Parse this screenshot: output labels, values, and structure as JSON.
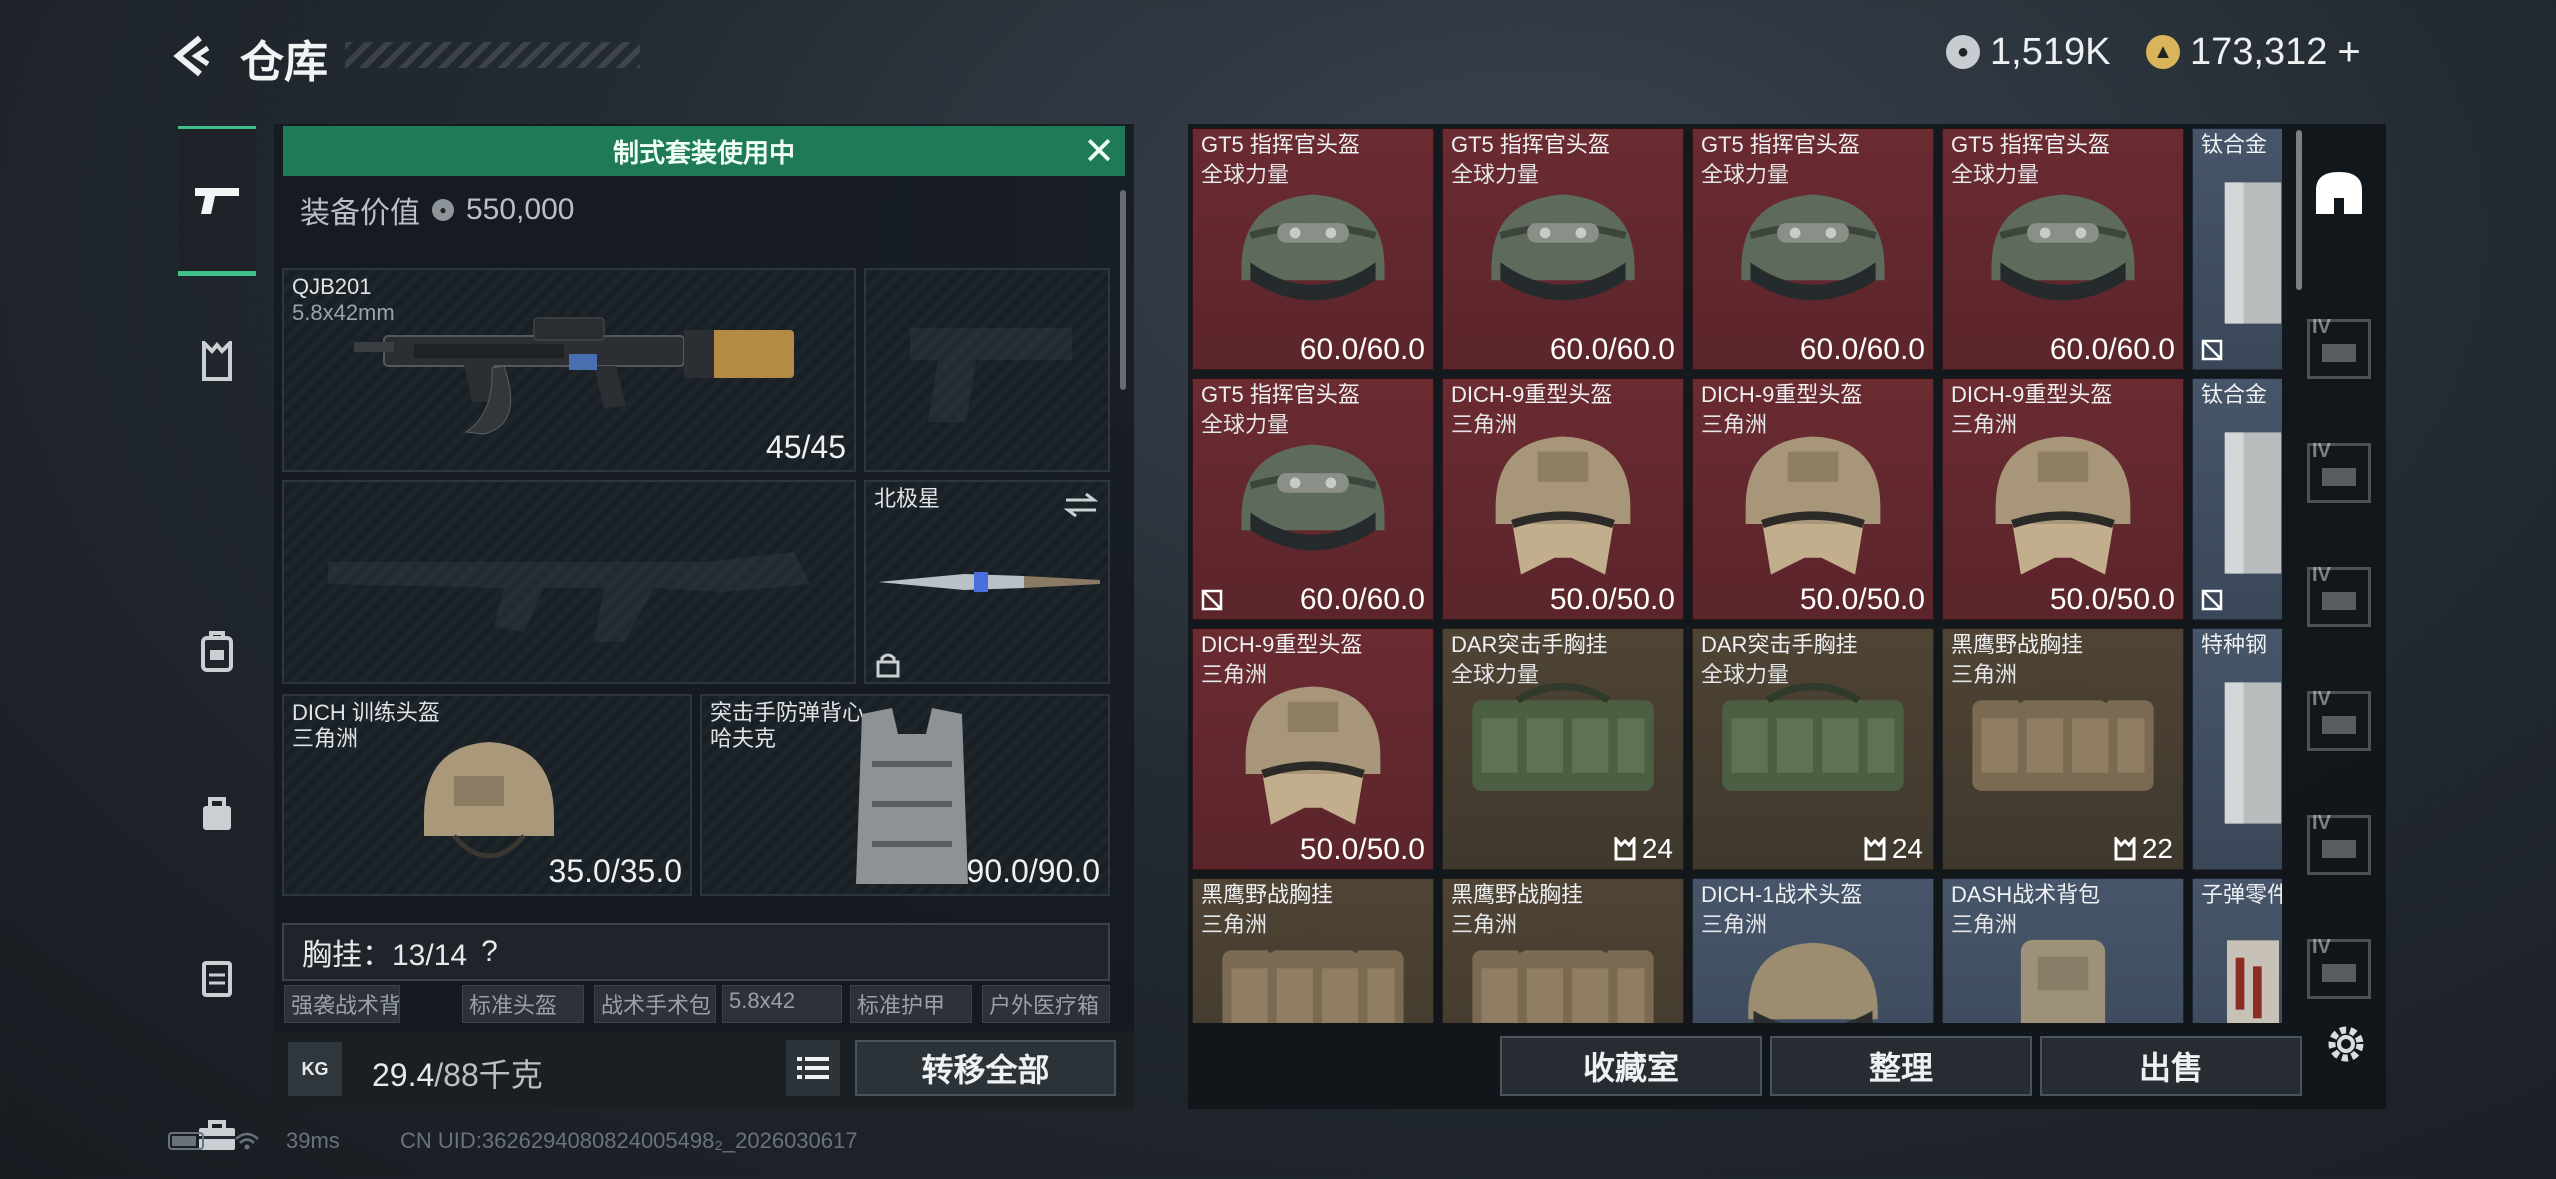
{
  "header": {
    "title": "仓库",
    "currency_primary": "1,519K",
    "currency_secondary": "173,312",
    "currency_add": "+"
  },
  "loadout": {
    "banner": "制式套装使用中",
    "equip_value_label": "装备价值",
    "equip_value": "550,000",
    "primary_weapon": {
      "name": "QJB201",
      "caliber": "5.8x42mm",
      "ammo": "45/45"
    },
    "melee": {
      "name": "北极星"
    },
    "helmet": {
      "name": "DICH 训练头盔",
      "map": "三角洲",
      "durability": "35.0/35.0"
    },
    "armor": {
      "name": "突击手防弹背心",
      "map": "哈夫克",
      "durability": "90.0/90.0"
    },
    "chest_label": "胸挂：13/14",
    "chest_help": "?",
    "chips": [
      "强袭战术背心",
      "标准头盔",
      "战术手术包",
      "5.8x42",
      "标准护甲",
      "户外医疗箱"
    ],
    "weight": "29.4",
    "weight_max": "/88千克",
    "kg_label": "KG",
    "transfer_all": "转移全部"
  },
  "inventory": {
    "items": [
      {
        "name": "GT5 指挥官头盔",
        "sub": "全球力量",
        "value": "60.0/60.0",
        "color": "red",
        "kind": "helmet-gt5"
      },
      {
        "name": "GT5 指挥官头盔",
        "sub": "全球力量",
        "value": "60.0/60.0",
        "color": "red",
        "kind": "helmet-gt5"
      },
      {
        "name": "GT5 指挥官头盔",
        "sub": "全球力量",
        "value": "60.0/60.0",
        "color": "red",
        "kind": "helmet-gt5"
      },
      {
        "name": "GT5 指挥官头盔",
        "sub": "全球力量",
        "value": "60.0/60.0",
        "color": "red",
        "kind": "helmet-gt5"
      },
      {
        "name": "钛合金",
        "sub": "",
        "value": "",
        "color": "blue",
        "kind": "plate"
      },
      {
        "name": "GT5 指挥官头盔",
        "sub": "全球力量",
        "value": "60.0/60.0",
        "color": "red",
        "kind": "helmet-gt5"
      },
      {
        "name": "DICH-9重型头盔",
        "sub": "三角洲",
        "value": "50.0/50.0",
        "color": "red",
        "kind": "helmet-dich9"
      },
      {
        "name": "DICH-9重型头盔",
        "sub": "三角洲",
        "value": "50.0/50.0",
        "color": "red",
        "kind": "helmet-dich9"
      },
      {
        "name": "DICH-9重型头盔",
        "sub": "三角洲",
        "value": "50.0/50.0",
        "color": "red",
        "kind": "helmet-dich9"
      },
      {
        "name": "钛合金",
        "sub": "",
        "value": "",
        "color": "blue",
        "kind": "plate"
      },
      {
        "name": "DICH-9重型头盔",
        "sub": "三角洲",
        "value": "50.0/50.0",
        "color": "red",
        "kind": "helmet-dich9"
      },
      {
        "name": "DAR突击手胸挂",
        "sub": "全球力量",
        "value": "24",
        "color": "brown",
        "kind": "rig-green"
      },
      {
        "name": "DAR突击手胸挂",
        "sub": "全球力量",
        "value": "24",
        "color": "brown",
        "kind": "rig-green"
      },
      {
        "name": "黑鹰野战胸挂",
        "sub": "三角洲",
        "value": "22",
        "color": "brown",
        "kind": "rig-tan"
      },
      {
        "name": "特种钢",
        "sub": "",
        "value": "",
        "color": "blue",
        "kind": "plate"
      },
      {
        "name": "黑鹰野战胸挂",
        "sub": "三角洲",
        "value": "",
        "color": "brown",
        "kind": "rig-tan"
      },
      {
        "name": "黑鹰野战胸挂",
        "sub": "三角洲",
        "value": "",
        "color": "brown",
        "kind": "rig-tan"
      },
      {
        "name": "DICH-1战术头盔",
        "sub": "三角洲",
        "value": "",
        "color": "blue",
        "kind": "helmet-dich1"
      },
      {
        "name": "DASH战术背包",
        "sub": "三角洲",
        "value": "",
        "color": "blue",
        "kind": "backpack"
      },
      {
        "name": "子弹零件切",
        "sub": "",
        "value": "",
        "color": "blue",
        "kind": "ammo"
      }
    ],
    "buttons": {
      "collection": "收藏室",
      "sort": "整理",
      "sell": "出售"
    },
    "rail_labels": [
      "IV",
      "IV",
      "IV",
      "IV",
      "IV",
      "IV"
    ]
  },
  "status": {
    "ping": "39ms",
    "uid": "CN UID:3626294080824005498₂_2026030617"
  },
  "colors": {
    "accent": "#3fc28a",
    "banner": "#1f7b57",
    "cell_red": "#6a2b31",
    "cell_brown": "#4f4434",
    "cell_blue": "#47556a"
  }
}
